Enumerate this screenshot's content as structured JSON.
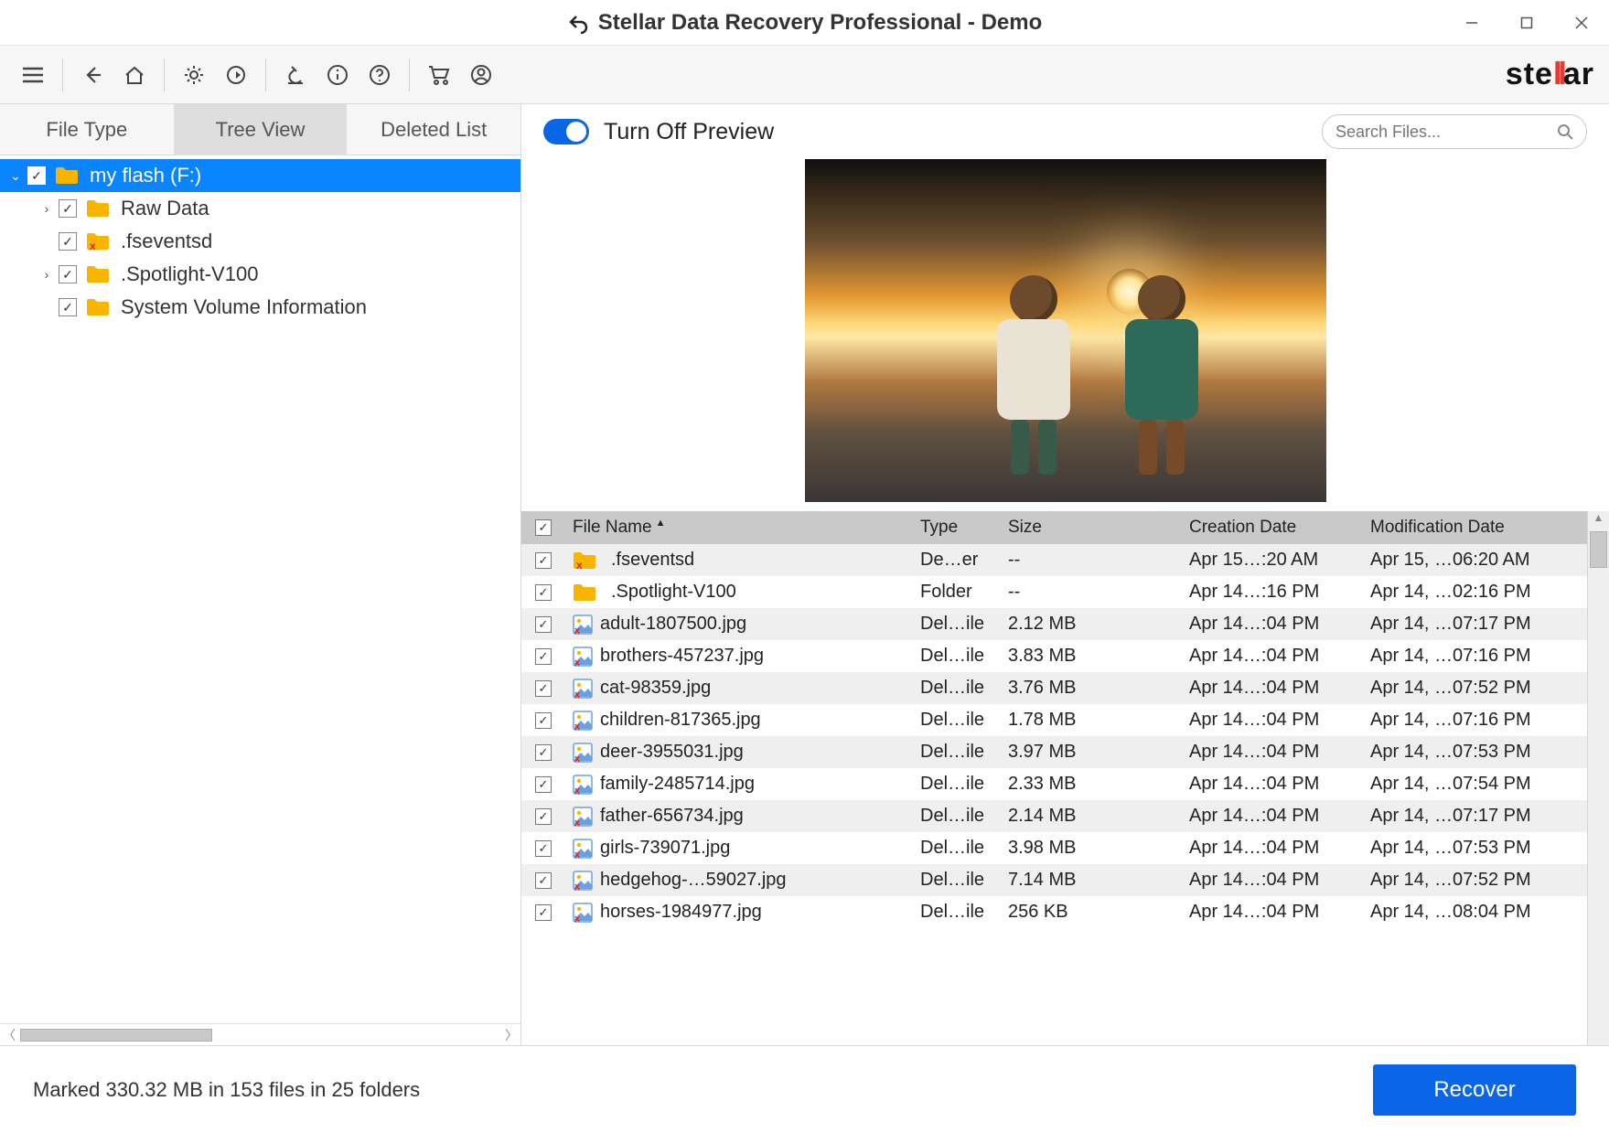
{
  "window": {
    "title": "Stellar Data Recovery Professional - Demo"
  },
  "toolbar_icons": [
    "hamburger",
    "back",
    "home",
    "settings",
    "reload",
    "microscope",
    "info",
    "help",
    "cart",
    "user"
  ],
  "brand": {
    "pre": "ste",
    "mid": "ll",
    "post": "ar"
  },
  "left_tabs": {
    "type": "File Type",
    "tree": "Tree View",
    "deleted": "Deleted List",
    "active": "tree"
  },
  "tree": [
    {
      "label": "my flash (F:)",
      "depth": 0,
      "checked": true,
      "icon": "folder",
      "expand": "down",
      "selected": true
    },
    {
      "label": "Raw Data",
      "depth": 1,
      "checked": true,
      "icon": "folder",
      "expand": "right"
    },
    {
      "label": ".fseventsd",
      "depth": 1,
      "checked": true,
      "icon": "folder-del",
      "expand": ""
    },
    {
      "label": ".Spotlight-V100",
      "depth": 1,
      "checked": true,
      "icon": "folder",
      "expand": "right"
    },
    {
      "label": "System Volume Information",
      "depth": 1,
      "checked": true,
      "icon": "folder",
      "expand": ""
    }
  ],
  "preview": {
    "toggle_label": "Turn Off Preview",
    "search_placeholder": "Search Files..."
  },
  "columns": {
    "name": "File Name",
    "type": "Type",
    "size": "Size",
    "cd": "Creation Date",
    "md": "Modification Date"
  },
  "files": [
    {
      "name": ".fseventsd",
      "icon": "folder-del",
      "type": "De…er",
      "size": "--",
      "cd": "Apr 15…:20 AM",
      "md": "Apr 15, …06:20 AM"
    },
    {
      "name": ".Spotlight-V100",
      "icon": "folder",
      "type": "Folder",
      "size": "--",
      "cd": "Apr 14…:16 PM",
      "md": "Apr 14, …02:16 PM"
    },
    {
      "name": "adult-1807500.jpg",
      "icon": "img-del",
      "type": "Del…ile",
      "size": "2.12 MB",
      "cd": "Apr 14…:04 PM",
      "md": "Apr 14, …07:17 PM"
    },
    {
      "name": "brothers-457237.jpg",
      "icon": "img-del",
      "type": "Del…ile",
      "size": "3.83 MB",
      "cd": "Apr 14…:04 PM",
      "md": "Apr 14, …07:16 PM"
    },
    {
      "name": "cat-98359.jpg",
      "icon": "img-del",
      "type": "Del…ile",
      "size": "3.76 MB",
      "cd": "Apr 14…:04 PM",
      "md": "Apr 14, …07:52 PM"
    },
    {
      "name": "children-817365.jpg",
      "icon": "img-del",
      "type": "Del…ile",
      "size": "1.78 MB",
      "cd": "Apr 14…:04 PM",
      "md": "Apr 14, …07:16 PM"
    },
    {
      "name": "deer-3955031.jpg",
      "icon": "img-del",
      "type": "Del…ile",
      "size": "3.97 MB",
      "cd": "Apr 14…:04 PM",
      "md": "Apr 14, …07:53 PM"
    },
    {
      "name": "family-2485714.jpg",
      "icon": "img-del",
      "type": "Del…ile",
      "size": "2.33 MB",
      "cd": "Apr 14…:04 PM",
      "md": "Apr 14, …07:54 PM"
    },
    {
      "name": "father-656734.jpg",
      "icon": "img-del",
      "type": "Del…ile",
      "size": "2.14 MB",
      "cd": "Apr 14…:04 PM",
      "md": "Apr 14, …07:17 PM"
    },
    {
      "name": "girls-739071.jpg",
      "icon": "img-del",
      "type": "Del…ile",
      "size": "3.98 MB",
      "cd": "Apr 14…:04 PM",
      "md": "Apr 14, …07:53 PM"
    },
    {
      "name": "hedgehog-…59027.jpg",
      "icon": "img-del",
      "type": "Del…ile",
      "size": "7.14 MB",
      "cd": "Apr 14…:04 PM",
      "md": "Apr 14, …07:52 PM"
    },
    {
      "name": "horses-1984977.jpg",
      "icon": "img-del",
      "type": "Del…ile",
      "size": "256 KB",
      "cd": "Apr 14…:04 PM",
      "md": "Apr 14, …08:04 PM"
    }
  ],
  "footer": {
    "status": "Marked 330.32 MB in 153 files in 25 folders",
    "recover": "Recover"
  }
}
